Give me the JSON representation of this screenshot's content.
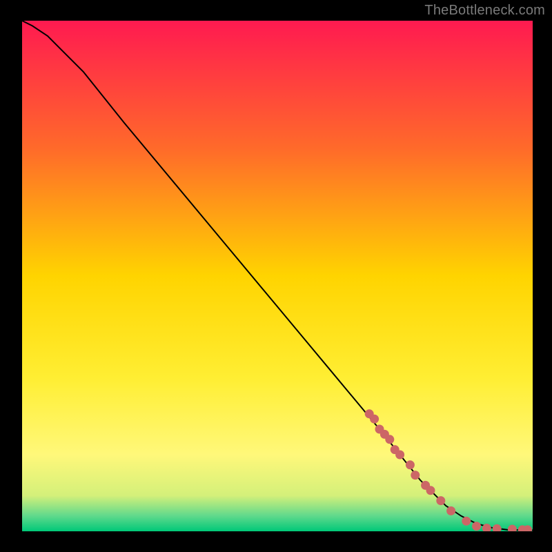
{
  "attribution": "TheBottleneck.com",
  "chart_data": {
    "type": "line",
    "title": "",
    "xlabel": "",
    "ylabel": "",
    "xlim": [
      0,
      100
    ],
    "ylim": [
      0,
      100
    ],
    "grid": false,
    "legend": false,
    "series": [
      {
        "name": "curve",
        "type": "line",
        "x": [
          0,
          2,
          5,
          8,
          12,
          20,
          30,
          40,
          50,
          60,
          70,
          78,
          83,
          86,
          89,
          92,
          95,
          100
        ],
        "y": [
          100,
          99,
          97,
          94,
          90,
          80,
          68,
          56,
          44,
          32,
          20,
          10,
          5,
          3,
          1.5,
          0.7,
          0.3,
          0.2
        ]
      },
      {
        "name": "points",
        "type": "scatter",
        "x": [
          68,
          69,
          70,
          71,
          72,
          73,
          74,
          76,
          77,
          79,
          80,
          82,
          84,
          87,
          89,
          91,
          93,
          96,
          98,
          99
        ],
        "y": [
          23,
          22,
          20,
          19,
          18,
          16,
          15,
          13,
          11,
          9,
          8,
          6,
          4,
          2,
          1,
          0.6,
          0.5,
          0.4,
          0.3,
          0.3
        ]
      }
    ],
    "gradient_stops": [
      {
        "offset": 0.0,
        "color": "#ff1a50"
      },
      {
        "offset": 0.25,
        "color": "#ff6a2a"
      },
      {
        "offset": 0.5,
        "color": "#ffd400"
      },
      {
        "offset": 0.7,
        "color": "#ffee33"
      },
      {
        "offset": 0.85,
        "color": "#fff87a"
      },
      {
        "offset": 0.93,
        "color": "#d4f07a"
      },
      {
        "offset": 0.97,
        "color": "#5fd98c"
      },
      {
        "offset": 1.0,
        "color": "#00c878"
      }
    ]
  }
}
